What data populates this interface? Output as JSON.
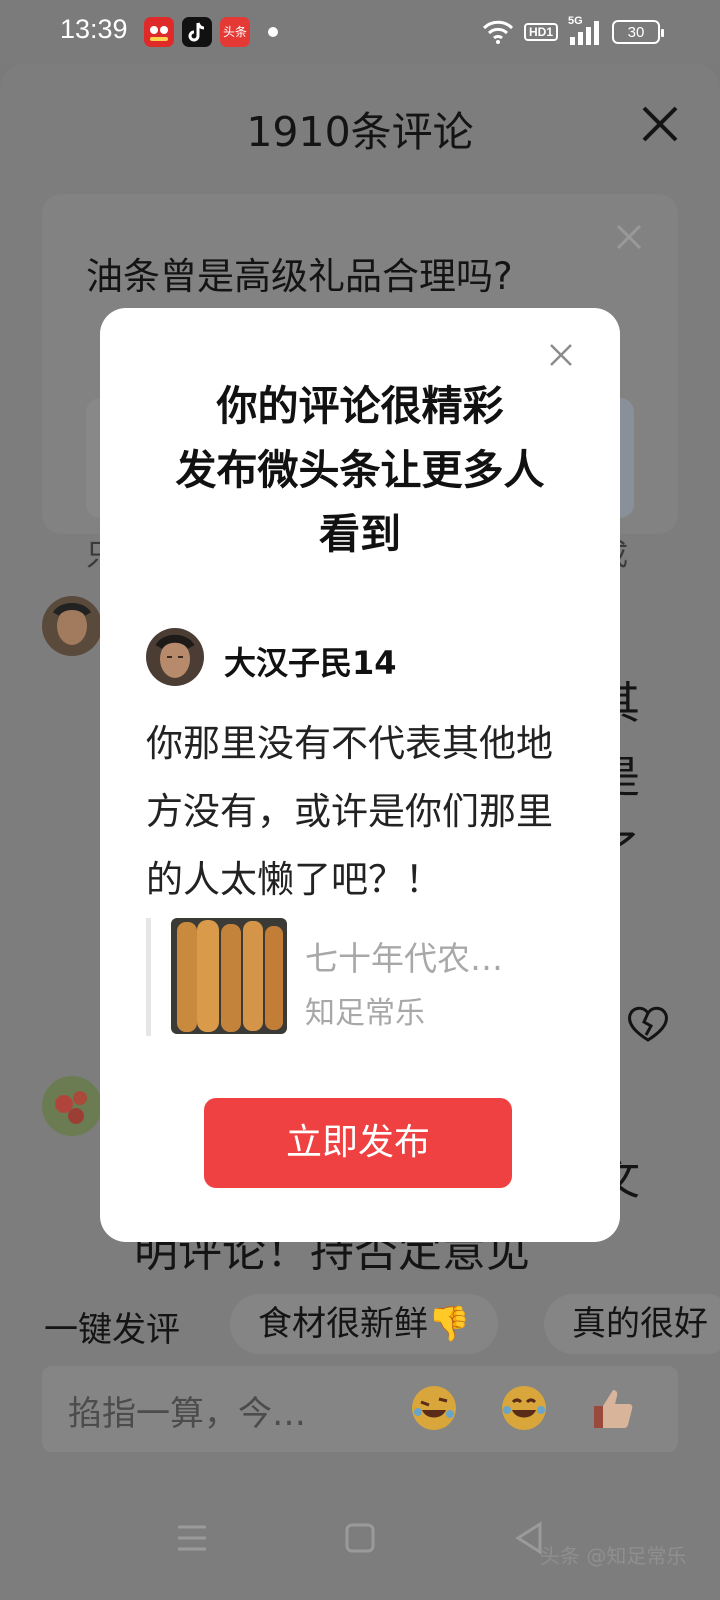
{
  "status_bar": {
    "time": "13:39",
    "app_icons": [
      "pinduoduo-icon",
      "tiktok-icon",
      "toutiao-icon"
    ],
    "toutiao_label": "头条",
    "hd_label": "HD1",
    "network_label": "5G",
    "battery": "30"
  },
  "sheet": {
    "title": "1910条评论",
    "topic_question": "油条曾是高级礼品合理吗?",
    "fragments": {
      "left_partial": "只",
      "right_partial": "成",
      "c1": "其",
      "c2": "是",
      "c3": "了",
      "c4": "文",
      "line": "明评论！持否定意见"
    },
    "quick_label": "一键发评",
    "chips": [
      "食材很新鲜👎",
      "真的很好"
    ],
    "input_placeholder": "掐指一算，今…",
    "emojis": [
      "rofl-emoji",
      "laugh-tears-emoji",
      "thumbs-up-emoji"
    ]
  },
  "modal": {
    "heading_lines": [
      "你的评论很精彩",
      "发布微头条让更多人",
      "看到"
    ],
    "user_name": "大汉子民14",
    "comment": "你那里没有不代表其他地方没有，或许是你们那里的人太懒了吧？！",
    "quote_title": "七十年代农…",
    "quote_author": "知足常乐",
    "publish_label": "立即发布"
  },
  "watermark": "头条 @知足常乐",
  "colors": {
    "publish_button": "#f04142",
    "overlay": "#7d7d7d",
    "modal_bg": "#ffffff"
  }
}
